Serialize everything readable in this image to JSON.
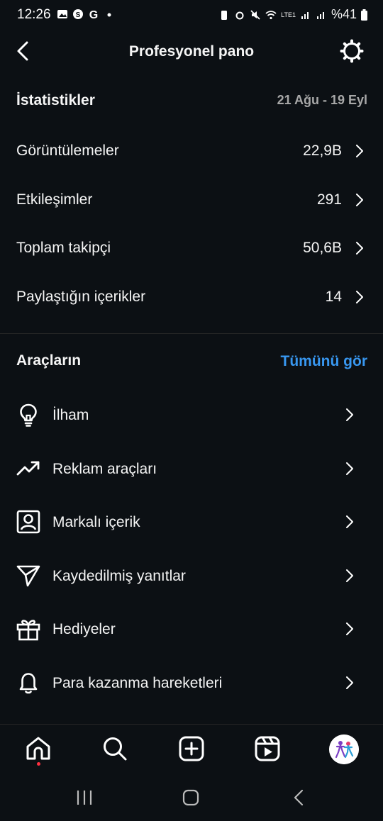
{
  "status_bar": {
    "time": "12:26",
    "battery": "%41",
    "network": "LTE1"
  },
  "header": {
    "title": "Profesyonel pano"
  },
  "stats": {
    "title": "İstatistikler",
    "date_range": "21 Ağu - 19 Eyl",
    "rows": [
      {
        "label": "Görüntülemeler",
        "value": "22,9B"
      },
      {
        "label": "Etkileşimler",
        "value": "291"
      },
      {
        "label": "Toplam takipçi",
        "value": "50,6B"
      },
      {
        "label": "Paylaştığın içerikler",
        "value": "14"
      }
    ]
  },
  "tools": {
    "title": "Araçların",
    "see_all": "Tümünü gör",
    "items": [
      {
        "label": "İlham",
        "icon": "lightbulb-icon"
      },
      {
        "label": "Reklam araçları",
        "icon": "trending-up-icon"
      },
      {
        "label": "Markalı içerik",
        "icon": "branded-content-icon"
      },
      {
        "label": "Kaydedilmiş yanıtlar",
        "icon": "send-icon"
      },
      {
        "label": "Hediyeler",
        "icon": "gift-icon"
      },
      {
        "label": "Para kazanma hareketleri",
        "icon": "bell-icon"
      }
    ]
  },
  "colors": {
    "background": "#0c1014",
    "text": "#f5f5f5",
    "muted": "#a8a8a8",
    "link": "#3897f0",
    "notification_dot": "#ff3040"
  }
}
